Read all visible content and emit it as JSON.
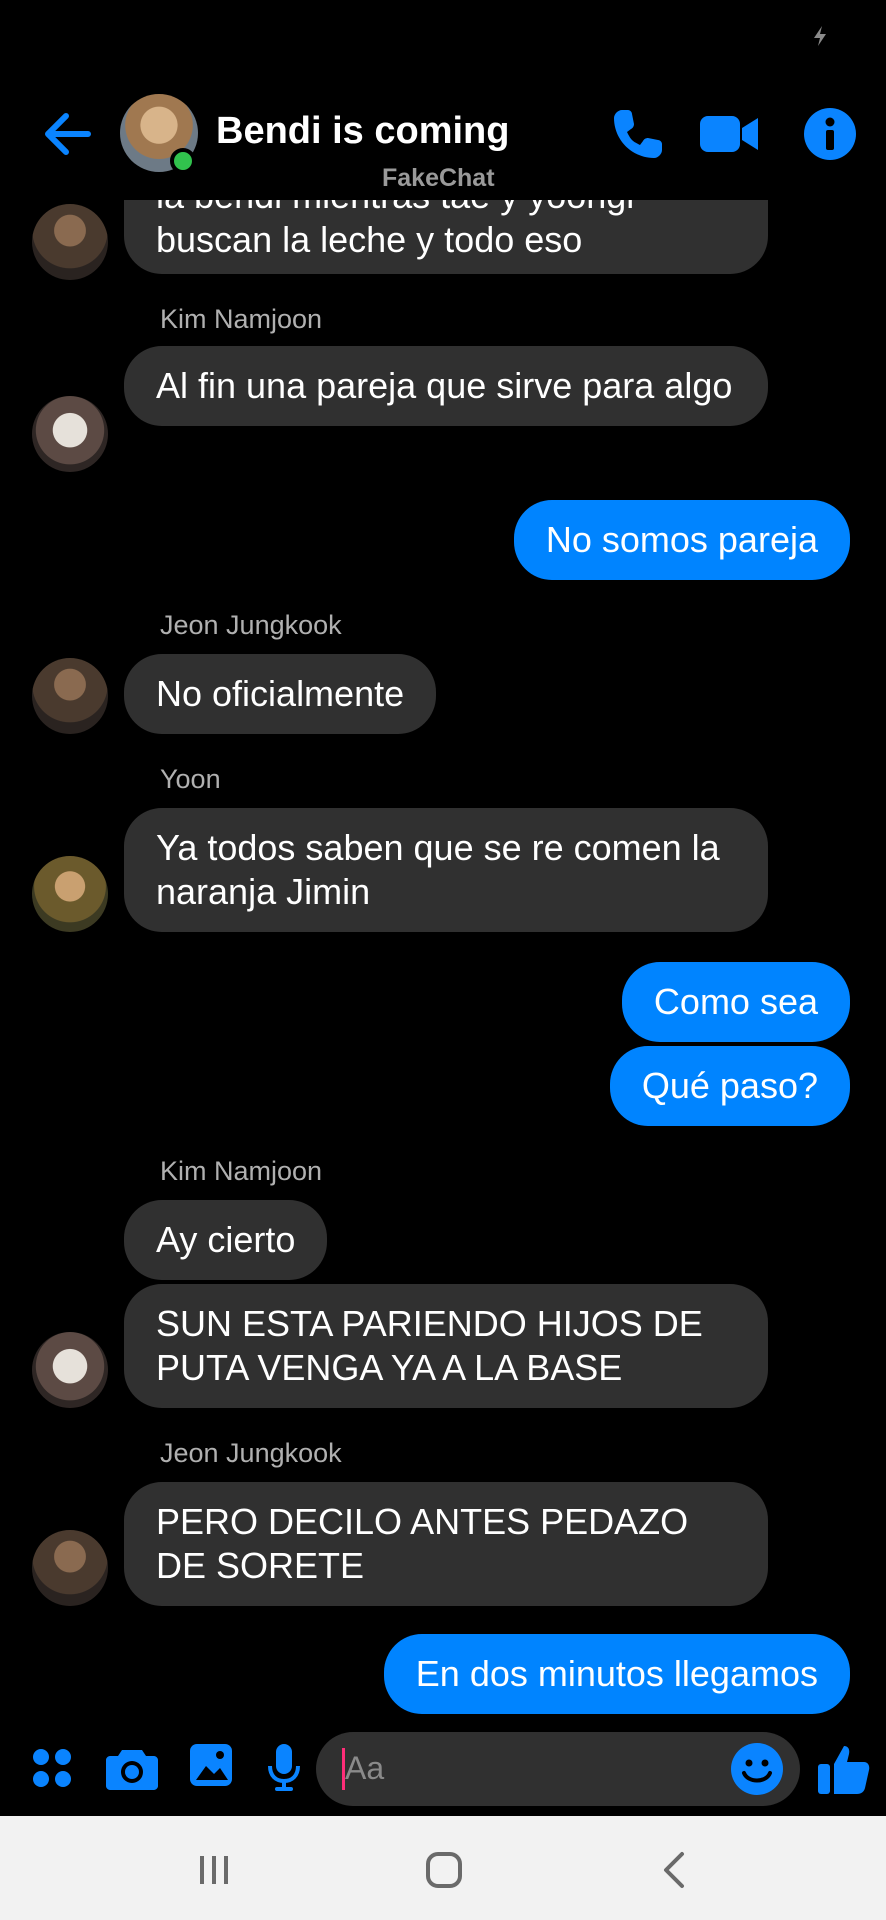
{
  "header": {
    "title": "Bendi is coming",
    "watermark": "FakeChat"
  },
  "messages": [
    {
      "type": "in",
      "text": "la bendi mientras tae y yoongi buscan la leche y todo eso",
      "avatar": "jungkook"
    },
    {
      "type": "sender",
      "text": "Kim Namjoon"
    },
    {
      "type": "in",
      "text": "Al fin una pareja que sirve para algo",
      "avatar": "namjoon"
    },
    {
      "type": "out",
      "text": "No  somos pareja"
    },
    {
      "type": "sender",
      "text": "Jeon Jungkook"
    },
    {
      "type": "in",
      "text": "No oficialmente",
      "avatar": "jungkook"
    },
    {
      "type": "sender",
      "text": "Yoon"
    },
    {
      "type": "in",
      "text": "Ya todos saben que se re comen la naranja Jimin",
      "avatar": "yoon"
    },
    {
      "type": "out",
      "text": "Como sea"
    },
    {
      "type": "out",
      "text": "Qué paso?"
    },
    {
      "type": "sender",
      "text": "Kim Namjoon"
    },
    {
      "type": "in",
      "text": "Ay cierto"
    },
    {
      "type": "in",
      "text": "SUN ESTA PARIENDO HIJOS DE PUTA VENGA YA A LA BASE",
      "avatar": "namjoon"
    },
    {
      "type": "sender",
      "text": "Jeon Jungkook"
    },
    {
      "type": "in",
      "text": "PERO DECILO ANTES PEDAZO DE SORETE",
      "avatar": "jungkook"
    },
    {
      "type": "out",
      "text": "En dos minutos llegamos"
    }
  ],
  "composer": {
    "placeholder": "Aa"
  },
  "colors": {
    "accent": "#0084ff",
    "incoming_bubble": "#303030",
    "background": "#000000",
    "online": "#31c24d"
  },
  "icons": [
    "back-arrow-icon",
    "phone-icon",
    "video-camera-icon",
    "info-icon",
    "apps-icon",
    "camera-icon",
    "image-icon",
    "microphone-icon",
    "emoji-icon",
    "thumbs-up-icon",
    "charging-icon"
  ]
}
